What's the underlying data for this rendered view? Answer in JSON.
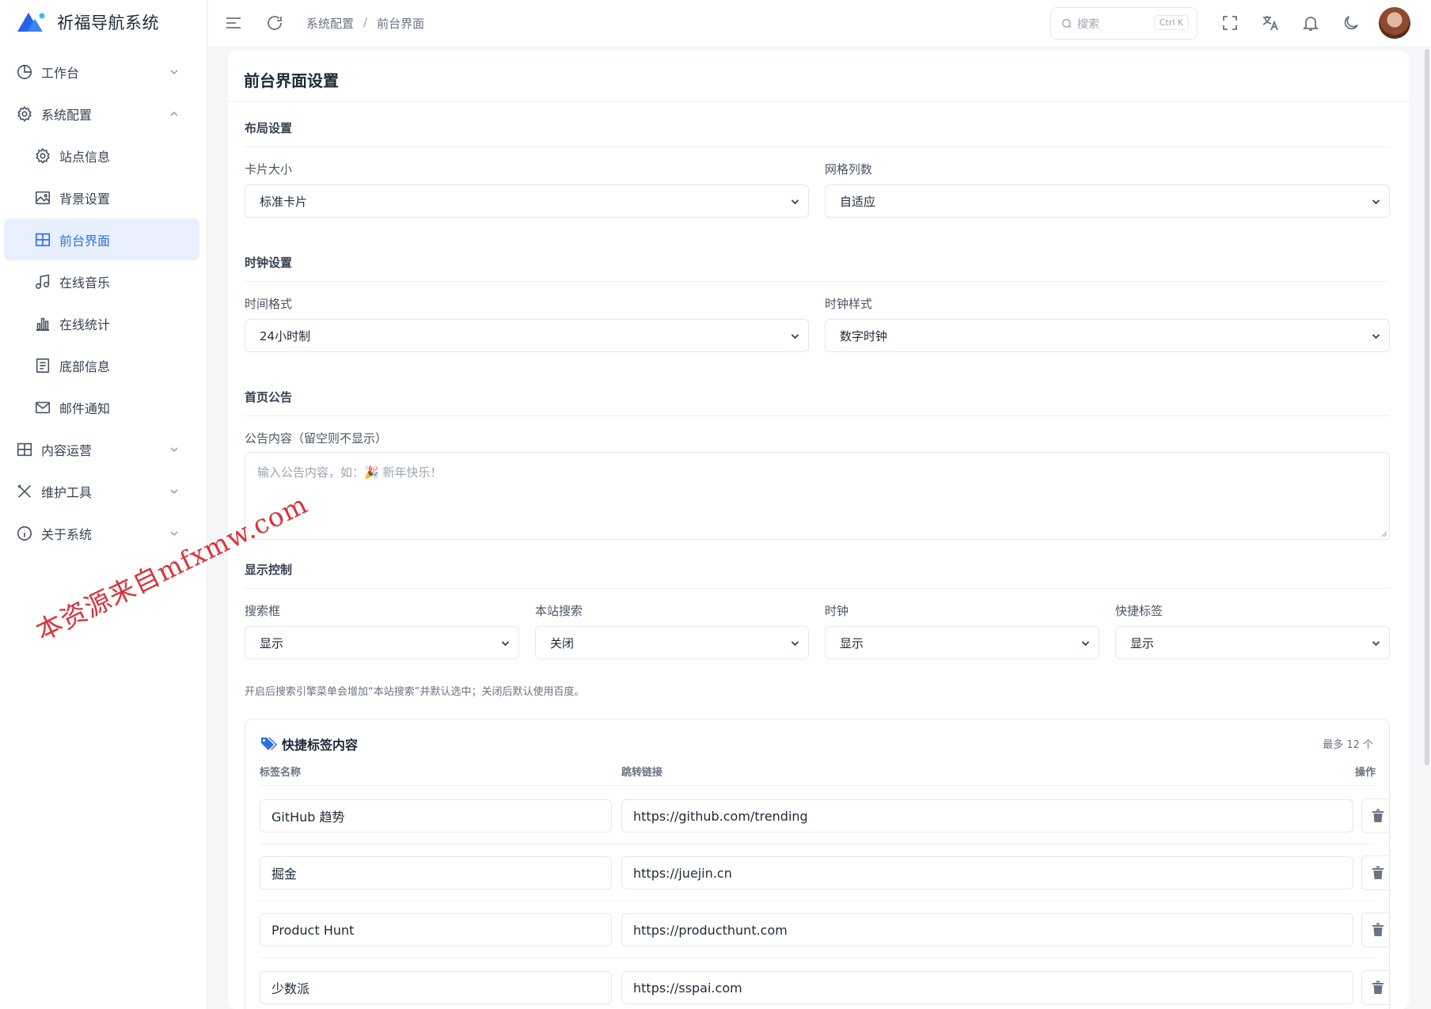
{
  "app": {
    "name": "祈福导航系统"
  },
  "sidebar": {
    "items": [
      {
        "label": "工作台",
        "icon": "clock-icon"
      },
      {
        "label": "系统配置",
        "icon": "gear-icon"
      },
      {
        "label": "站点信息",
        "icon": "gear-icon"
      },
      {
        "label": "背景设置",
        "icon": "image-icon"
      },
      {
        "label": "前台界面",
        "icon": "grid-icon"
      },
      {
        "label": "在线音乐",
        "icon": "music-icon"
      },
      {
        "label": "在线统计",
        "icon": "bar-chart-icon"
      },
      {
        "label": "底部信息",
        "icon": "document-icon"
      },
      {
        "label": "邮件通知",
        "icon": "mail-icon"
      },
      {
        "label": "内容运营",
        "icon": "grid-icon"
      },
      {
        "label": "维护工具",
        "icon": "tools-icon"
      },
      {
        "label": "关于系统",
        "icon": "info-icon"
      }
    ]
  },
  "header": {
    "breadcrumb": [
      "系统配置",
      "/",
      "前台界面"
    ],
    "search_placeholder": "搜索",
    "search_shortcut": "Ctrl K"
  },
  "page": {
    "title": "前台界面设置",
    "layout": {
      "section": "布局设置",
      "card_size_label": "卡片大小",
      "card_size_value": "标准卡片",
      "grid_cols_label": "网格列数",
      "grid_cols_value": "自适应"
    },
    "clock": {
      "section": "时钟设置",
      "time_format_label": "时间格式",
      "time_format_value": "24小时制",
      "clock_style_label": "时钟样式",
      "clock_style_value": "数字时钟"
    },
    "notice": {
      "section": "首页公告",
      "content_label": "公告内容（留空则不显示）",
      "placeholder": "输入公告内容，如：🎉 新年快乐！"
    },
    "display": {
      "section": "显示控制",
      "search_box_label": "搜索框",
      "search_box_value": "显示",
      "site_search_label": "本站搜索",
      "site_search_value": "关闭",
      "clock_label": "时钟",
      "clock_value": "显示",
      "quick_tags_label": "快捷标签",
      "quick_tags_value": "显示",
      "hint": "开启后搜索引擎菜单会增加“本站搜索”并默认选中；关闭后默认使用百度。"
    },
    "quick_tags": {
      "title": "快捷标签内容",
      "max": "最多 12 个",
      "col_name": "标签名称",
      "col_link": "跳转链接",
      "col_action": "操作",
      "rows": [
        {
          "name": "GitHub 趋势",
          "url": "https://github.com/trending"
        },
        {
          "name": "掘金",
          "url": "https://juejin.cn"
        },
        {
          "name": "Product Hunt",
          "url": "https://producthunt.com"
        },
        {
          "name": "少数派",
          "url": "https://sspai.com"
        }
      ]
    }
  },
  "watermark": "本资源来自mfxmw.com"
}
